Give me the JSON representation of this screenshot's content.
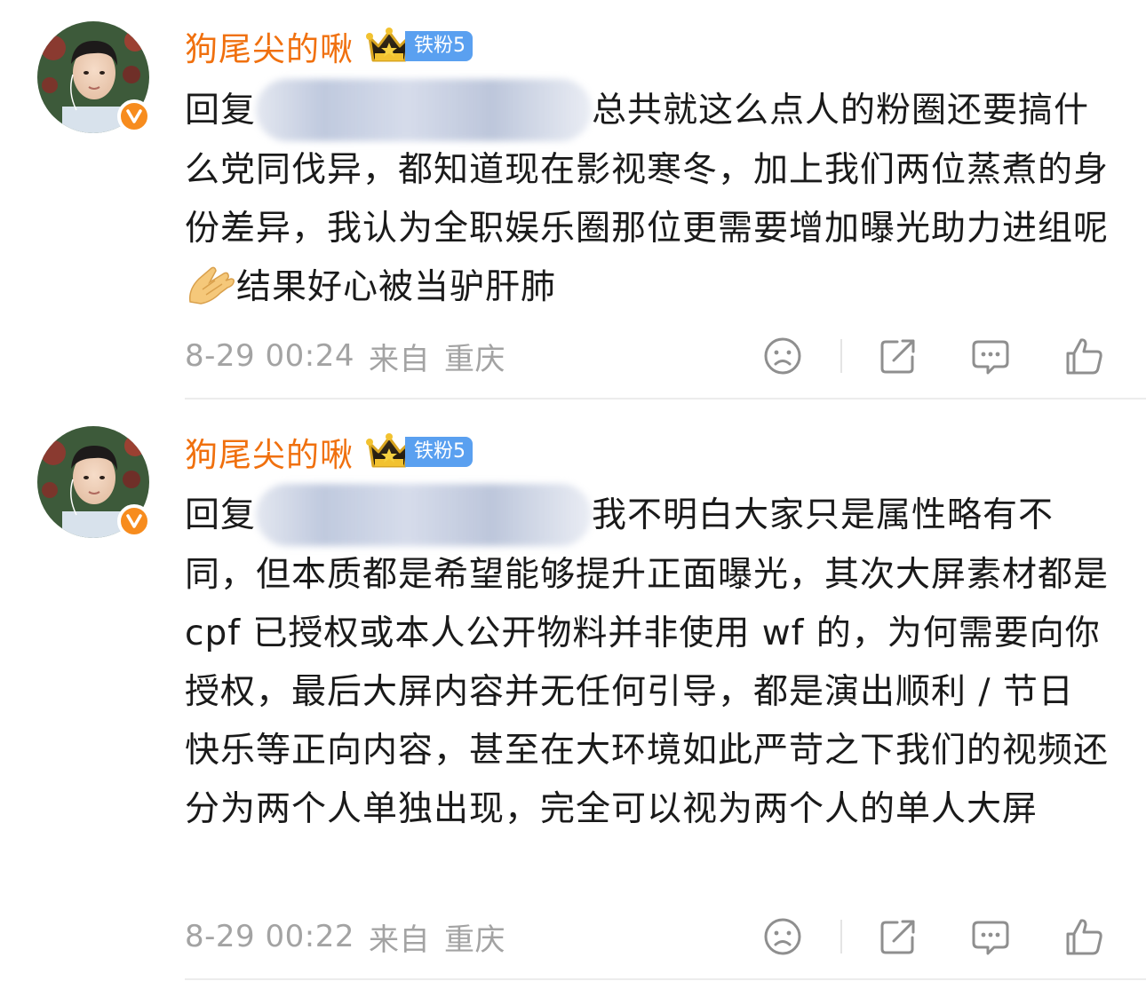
{
  "comments": [
    {
      "username": "狗尾尖的啾",
      "fan_badge": "铁粉5",
      "reply_prefix": "回复",
      "text_after_mask": "总共就这么点人的粉圈还要搞什么党同伐异，都知道现在影视寒冬，加上我们两位蒸煮的身份差异，我认为全职娱乐圈那位更需要增加曝光助力进组呢",
      "text_after_emoji": "结果好心被当驴肝肺",
      "emoji": "folded-hands-emoji",
      "time": "8-29 00:24",
      "source_label": "来自",
      "location": "重庆"
    },
    {
      "username": "狗尾尖的啾",
      "fan_badge": "铁粉5",
      "reply_prefix": "回复",
      "text_after_mask": "我不明白大家只是属性略有不同，但本质都是希望能够提升正面曝光，其次大屏素材都是 cpf 已授权或本人公开物料并非使用 wf 的，为何需要向你授权，最后大屏内容并无任何引导，都是演出顺利 / 节日快乐等正向内容，甚至在大环境如此严苛之下我们的视频还分为两个人单独出现，完全可以视为两个人的单人大屏",
      "time": "8-29 00:22",
      "source_label": "来自",
      "location": "重庆"
    }
  ],
  "icons": {
    "dislike": "sad-face-icon",
    "share": "share-icon",
    "comment": "comment-icon",
    "like": "thumbs-up-icon",
    "verified": "verified-v-icon",
    "crown": "crown-icon"
  },
  "colors": {
    "username": "#f0700e",
    "fan_badge": "#5aa0f0",
    "verified": "#f78c1e",
    "meta_text": "#a3a3a3",
    "body_text": "#1a1a1a"
  }
}
